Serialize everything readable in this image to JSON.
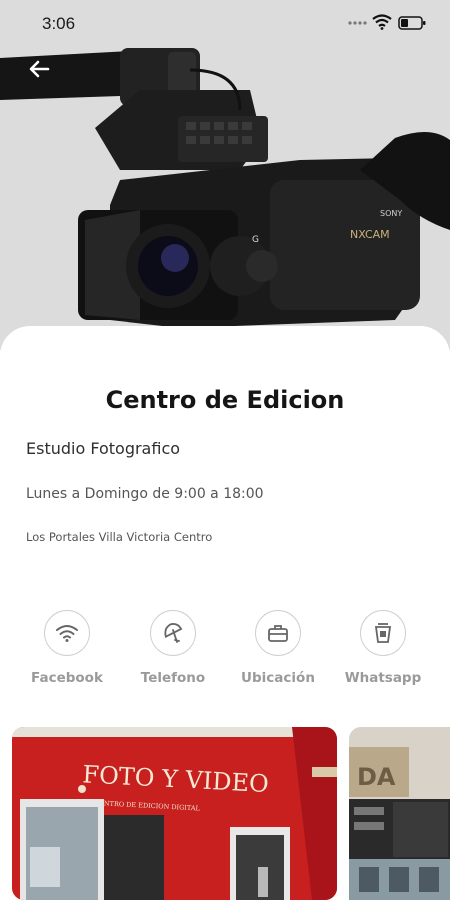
{
  "status_bar": {
    "time": "3:06"
  },
  "header": {
    "back_icon": "arrow-left-icon",
    "hero_image": "video-camera-photo"
  },
  "business": {
    "name": "Centro de Edicion",
    "category": "Estudio Fotografico",
    "hours": "Lunes a Domingo de 9:00 a 18:00",
    "address": "Los Portales Villa Victoria Centro"
  },
  "actions": [
    {
      "label": "Facebook",
      "icon": "wifi-icon"
    },
    {
      "label": "Telefono",
      "icon": "umbrella-icon"
    },
    {
      "label": "Ubicación",
      "icon": "briefcase-icon"
    },
    {
      "label": "Whatsapp",
      "icon": "cup-icon"
    }
  ],
  "gallery": {
    "photo1_sign_line1": "FOTO Y VIDEO",
    "photo1_sign_line2": "CENTRO DE EDICION DIGITAL"
  },
  "colors": {
    "hero_bg": "#dcdcdc",
    "storefront_red": "#c8201e",
    "label_gray": "#9a9a9a"
  }
}
